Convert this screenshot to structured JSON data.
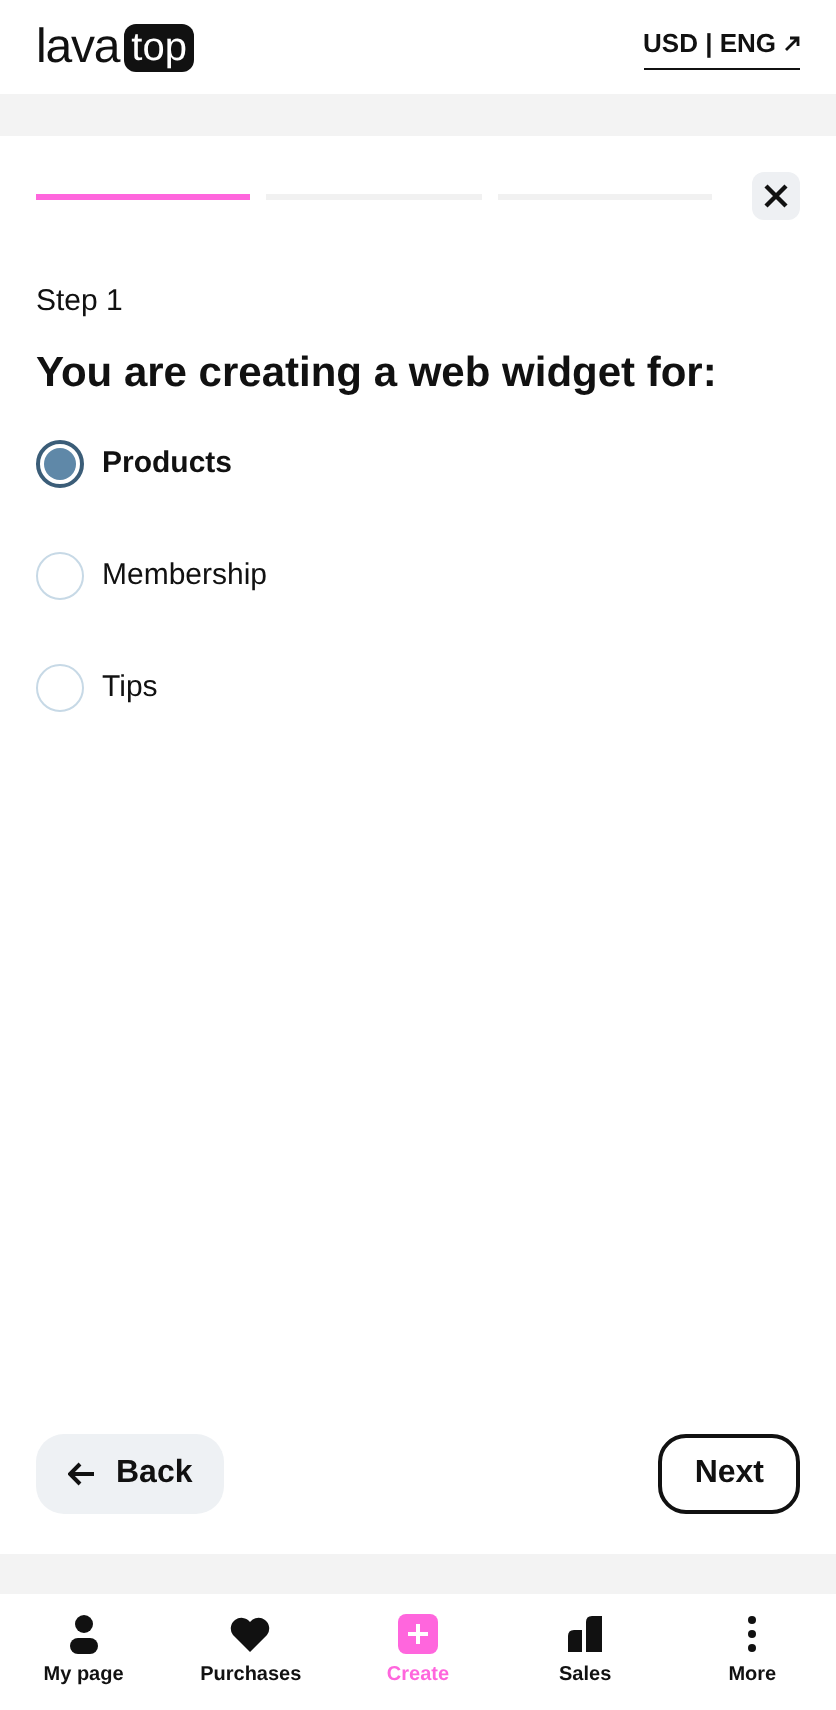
{
  "header": {
    "logo_word": "lava",
    "logo_badge": "top",
    "locale_link": "USD | ENG"
  },
  "progress": [
    {
      "done": true
    },
    {
      "done": false
    },
    {
      "done": false
    }
  ],
  "step_label": "Step 1",
  "question": "You are creating a web widget for:",
  "options": [
    {
      "label": "Products",
      "selected": true
    },
    {
      "label": "Membership",
      "selected": false
    },
    {
      "label": "Tips",
      "selected": false
    }
  ],
  "buttons": {
    "back": "Back",
    "next": "Next"
  },
  "nav": [
    {
      "kind": "person",
      "label": "My page",
      "selected": false
    },
    {
      "kind": "heart",
      "label": "Purchases",
      "selected": false
    },
    {
      "kind": "plus",
      "label": "Create",
      "selected": true
    },
    {
      "kind": "bars",
      "label": "Sales",
      "selected": false
    },
    {
      "kind": "dots",
      "label": "More",
      "selected": false
    }
  ]
}
